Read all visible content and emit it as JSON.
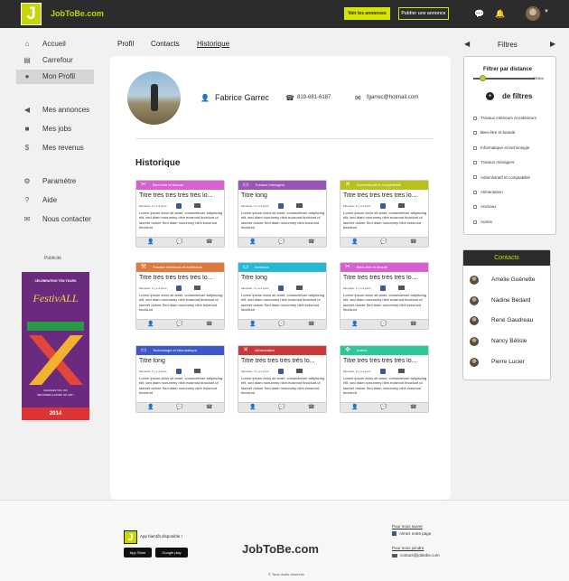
{
  "topbar": {
    "logo_letter": "J",
    "brand": "JobToBe.com",
    "see_ads": "Voir les annonces",
    "post_ad": "Publier une annonce",
    "accent": "#c6d600"
  },
  "sidebar": {
    "items": [
      {
        "label": "Accueil",
        "icon": "home-icon"
      },
      {
        "label": "Carrefour",
        "icon": "board-icon"
      },
      {
        "label": "Mon Profil",
        "icon": "user-icon",
        "active": true
      },
      {
        "label": "Mes annonces",
        "icon": "megaphone-icon"
      },
      {
        "label": "Mes jobs",
        "icon": "briefcase-icon"
      },
      {
        "label": "Mes revenus",
        "icon": "money-icon"
      },
      {
        "label": "Paramètre",
        "icon": "gear-icon"
      },
      {
        "label": "Aide",
        "icon": "help-icon"
      },
      {
        "label": "Nous contacter",
        "icon": "envelope-icon"
      }
    ],
    "publicity": "Publicité",
    "ad": {
      "line1": "CELEBRATING TEN YEARS",
      "title": "FestivALL",
      "footer1": "CHARLESTON, WV",
      "footer2": "BECOMES A WORK OF ART!",
      "year": "2014"
    }
  },
  "tabs": [
    "Profil",
    "Contacts",
    "Historique"
  ],
  "profile": {
    "name": "Fabrice Garrec",
    "phone": "819-681-6187",
    "email": "fgarrec@hotmail.com"
  },
  "history_title": "Historique",
  "jobs": [
    {
      "category": "Bien-être et beauté",
      "color": "#d860d0",
      "icon": "scissors-icon",
      "title": "Titre très très très très lo...",
      "meta": "Montréal - Il y a 2 jours"
    },
    {
      "category": "Travaux ménagers",
      "color": "#9a55b8",
      "icon": "monitor-icon",
      "title": "Titre long",
      "meta": "Montréal - Il y a 2 jours"
    },
    {
      "category": "Administratif et comptabilité",
      "color": "#b8c21e",
      "icon": "tools-icon",
      "title": "Titre très très très très lo...",
      "meta": "Montréal - Il y a 2 jours"
    },
    {
      "category": "Travaux intérieurs et extérieurs",
      "color": "#e07a3c",
      "icon": "hammer-icon",
      "title": "Titre très très très très lo...",
      "meta": "Montréal - Il y a 2 jours"
    },
    {
      "category": "Animaux",
      "color": "#27b8d6",
      "icon": "monitor-icon",
      "title": "Titre long",
      "meta": "Montréal - Il y a 2 jours"
    },
    {
      "category": "Bien-être et beauté",
      "color": "#d860d0",
      "icon": "scissors-icon",
      "title": "Titre très très très très lo...",
      "meta": "Montréal - Il y a 2 jours"
    },
    {
      "category": "Technologie et informatique",
      "color": "#3d59c8",
      "icon": "monitor-icon",
      "title": "Titre long",
      "meta": "Montréal - Il y a 2 jours"
    },
    {
      "category": "Alimentation",
      "color": "#c83a3a",
      "icon": "tools-icon",
      "title": "Titre très très très très lo...",
      "meta": "Montréal - Il y a 2 jours"
    },
    {
      "category": "Autres",
      "color": "#2ec79a",
      "icon": "compass-icon",
      "title": "Titre très très très très lo...",
      "meta": "Montréal - Il y a 2 jours"
    }
  ],
  "job_text": "Lorem ipsum dolor sit amet, consectetuer adipiscing elit, sed diam nonummy nibh euismod tincidunt ut laoreet dolore Sed diam nonummy nibh euismod tincidunt",
  "filters": {
    "title": "Filtres",
    "distance_label": "Filtrer par distance",
    "distance_value": "150km",
    "distance_fraction": 0.15,
    "more_filters": "de filtres",
    "items": [
      "Travaux intérieurs et extérieurs",
      "Bien-être et beauté",
      "Informatique et technologie",
      "Travaux ménagers",
      "Administratif et comptabilité",
      "Alimentation",
      "Animaux",
      "Autres"
    ]
  },
  "contacts": {
    "title": "Contacts",
    "items": [
      "Amélie Guénette",
      "Nadine Bédard",
      "René Gaudreau",
      "Nancy Bélisle",
      "Pierre Lucier"
    ]
  },
  "footer": {
    "app_available": "App bientôt disponible !",
    "app_store": "App Store",
    "google_play": "Google play",
    "brand": "JobToBe.com",
    "follow_title": "Pour nous suivre",
    "follow_link": "Aimez notre page",
    "join_title": "Pour nous joindre",
    "join_link": "contact@jobtobe.com",
    "copyright": "© Tous droits réservés"
  }
}
